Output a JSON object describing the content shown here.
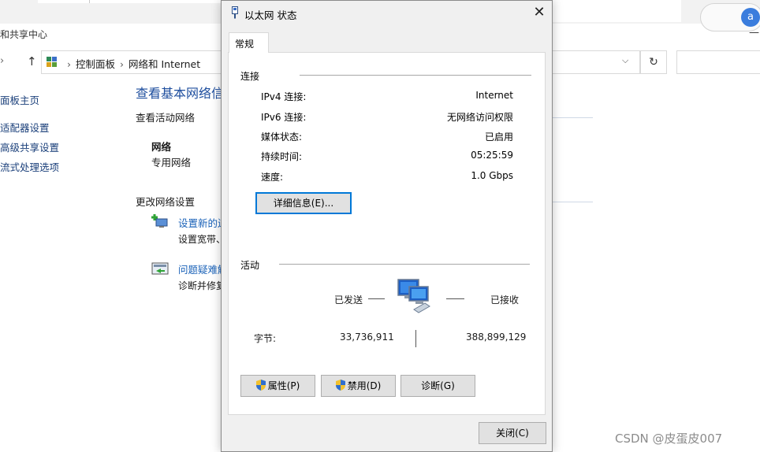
{
  "background_window": {
    "title": "和共享中心",
    "minimize_glyph": "—",
    "address_bar": {
      "crumbs": [
        "控制面板",
        "网络和 Internet"
      ],
      "separator": "›"
    },
    "sidebar": {
      "items": [
        "面板主页",
        "适配器设置",
        "高级共享设置",
        "流式处理选项"
      ]
    },
    "main": {
      "heading": "查看基本网络信",
      "active_networks_label": "查看活动网络",
      "network_name": "网络",
      "network_type": "专用网络",
      "change_settings_label": "更改网络设置",
      "setup_link": "设置新的连",
      "setup_desc": "设置宽带、",
      "troubleshoot_link": "问题疑难解",
      "troubleshoot_desc": "诊断并修复"
    }
  },
  "browser": {
    "avatar_letter": "a"
  },
  "dialog": {
    "title": "以太网 状态",
    "tab_label": "常规",
    "connection": {
      "group_label": "连接",
      "rows": [
        {
          "label": "IPv4 连接:",
          "value": "Internet"
        },
        {
          "label": "IPv6 连接:",
          "value": "无网络访问权限"
        },
        {
          "label": "媒体状态:",
          "value": "已启用"
        },
        {
          "label": "持续时间:",
          "value": "05:25:59"
        },
        {
          "label": "速度:",
          "value": "1.0 Gbps"
        }
      ],
      "details_button": "详细信息(E)..."
    },
    "activity": {
      "group_label": "活动",
      "sent_label": "已发送",
      "received_label": "已接收",
      "bytes_label": "字节:",
      "bytes_sent": "33,736,911",
      "bytes_received": "388,899,129"
    },
    "buttons": {
      "properties": "属性(P)",
      "disable": "禁用(D)",
      "diagnose": "诊断(G)",
      "close": "关闭(C)"
    }
  },
  "watermark": "CSDN @皮蛋皮007",
  "colors": {
    "link_blue": "#1a62b8",
    "heading_blue": "#1e4e9e",
    "focus_border": "#0078d7",
    "dialog_bg": "#f0f0f0"
  },
  "icons": {
    "dialog_title": "ethernet-cable-icon",
    "activity": "network-computer-icon",
    "uac": "uac-shield-icon",
    "close": "close-icon",
    "up": "up-arrow-icon",
    "refresh": "refresh-icon",
    "dropdown": "chevron-down-icon"
  }
}
